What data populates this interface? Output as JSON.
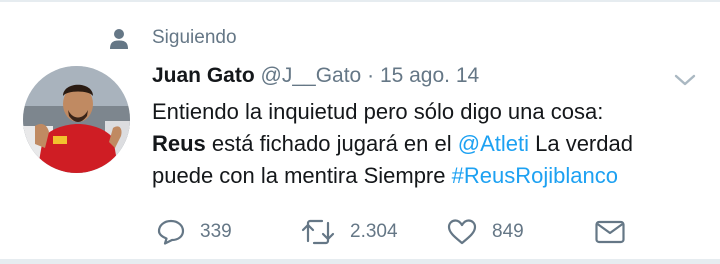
{
  "context": {
    "label": "Siguiendo",
    "icon": "person-icon"
  },
  "tweet": {
    "name": "Juan Gato",
    "handle": "@J__Gato",
    "separator": "·",
    "date": "15 ago. 14",
    "text": {
      "line1": "Entiendo la inquietud pero sólo digo una cosa:",
      "line2_bold": "Reus",
      "line2_plain": " está fichado jugará en el ",
      "line2_mention": "@Atleti",
      "line2_end": " La verdad",
      "line3_plain": "puede con la mentira Siempre ",
      "line3_hashtag": "#ReusRojiblanco"
    }
  },
  "actions": {
    "reply_count": "339",
    "retweet_count": "2.304",
    "like_count": "849"
  },
  "colors": {
    "text": "#14171a",
    "secondary": "#657786",
    "link": "#1da1f2",
    "divider": "#e6ecf0"
  }
}
